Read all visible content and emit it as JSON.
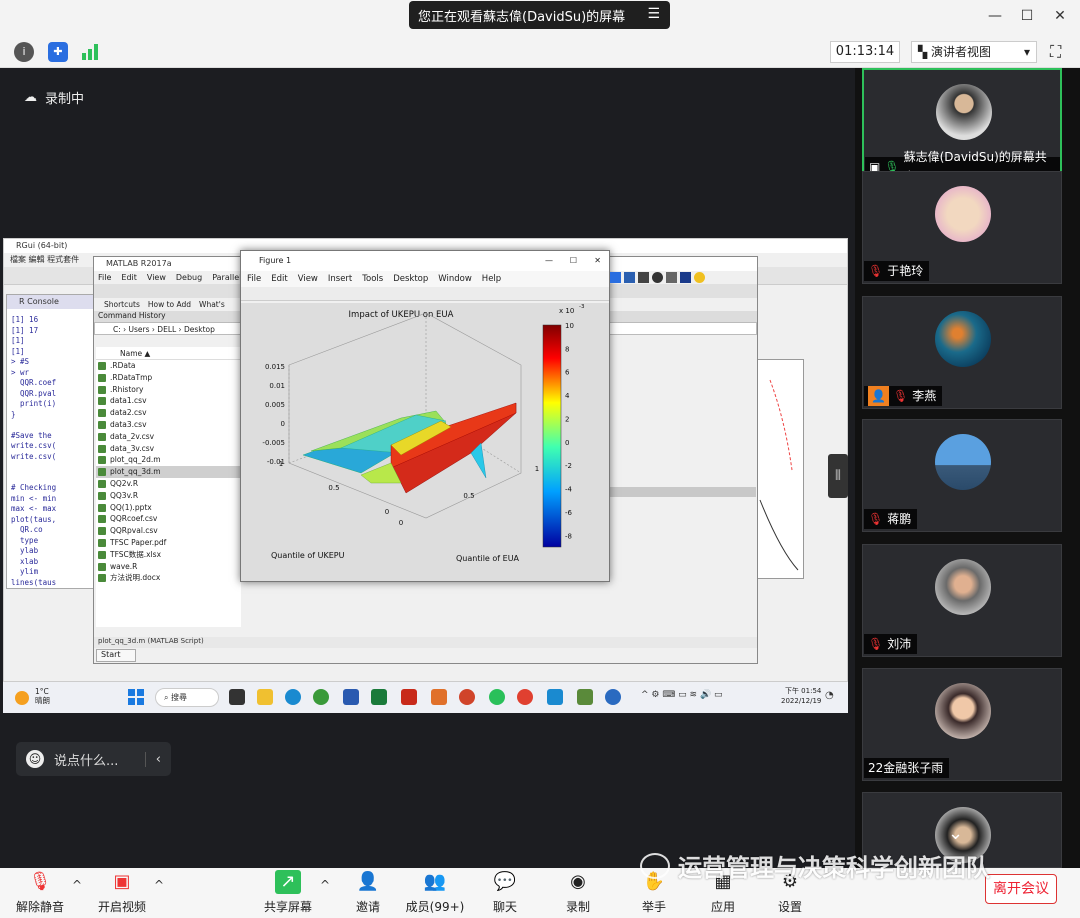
{
  "title_bar": {
    "share_banner": "您正在观看蘇志偉(DavidSu)的屏幕",
    "minimize": "—",
    "maximize": "☐",
    "close": "✕"
  },
  "info_bar": {
    "timer": "01:13:14",
    "view_label": "演讲者视图"
  },
  "stage": {
    "recording_label": "录制中"
  },
  "rgui": {
    "title": "RGui (64-bit)",
    "menu": "檔案  編輯  程式套件",
    "console_title": "R Console",
    "code": "[1] 16\n[1] 17\n[1]\n[1]\n> #S\n> wr\n  QQR.coef\n  QQR.pval\n  print(i)\n}\n\n#Save the\nwrite.csv(\nwrite.csv(\n\n\n# Checking\nmin <- min\nmax <- max\nplot(taus,\n  QR.co\n  type\n  ylab\n  xlab\n  ylim\nlines(taus"
  },
  "matlab": {
    "title": "MATLAB R2017a",
    "menu": [
      "File",
      "Edit",
      "View",
      "Debug",
      "Parallel"
    ],
    "shortcuts": "Shortcuts",
    "how_to_add": "How to Add",
    "whats_new": "What's",
    "panel": "Command History",
    "path": "C:  ›  Users  ›  DELL  ›  Desktop",
    "name_col": "Name ▲",
    "files": [
      ".RData",
      ".RDataTmp",
      ".Rhistory",
      "data1.csv",
      "data2.csv",
      "data3.csv",
      "data_2v.csv",
      "data_3v.csv",
      "plot_qq_2d.m",
      "plot_qq_3d.m",
      "QQ2v.R",
      "QQ3v.R",
      "QQ(1).pptx",
      "QQRcoef.csv",
      "QQRpval.csv",
      "TFSC Paper.pdf",
      "TFSC数据.xlsx",
      "wave.R",
      "方法说明.docx"
    ],
    "status": "plot_qq_3d.m (MATLAB Script)",
    "start": "Start"
  },
  "figure": {
    "title": "Figure 1",
    "menu": [
      "File",
      "Edit",
      "View",
      "Insert",
      "Tools",
      "Desktop",
      "Window",
      "Help"
    ]
  },
  "chart_data": {
    "type": "surface",
    "title": "Impact of UKEPU on EUA",
    "xlabel": "Quantile of UKEPU",
    "ylabel": "Quantile of EUA",
    "zlim": [
      -0.01,
      0.015
    ],
    "z_ticks": [
      "0.015",
      "0.01",
      "0.005",
      "0",
      "-0.005",
      "-0.01"
    ],
    "x_ticks": [
      "1",
      "0.5",
      "0"
    ],
    "y_ticks": [
      "0",
      "0.5",
      "1"
    ],
    "colorbar": {
      "label": "x 10",
      "exponent": "-3",
      "ticks": [
        "10",
        "8",
        "6",
        "4",
        "2",
        "0",
        "-2",
        "-4",
        "-6",
        "-8"
      ],
      "range": [
        -9,
        10
      ]
    }
  },
  "taskbar": {
    "weather_temp": "1°C",
    "weather_desc": "晴朗",
    "search": "搜尋",
    "time": "下午 01:54",
    "date": "2022/12/19"
  },
  "chat": {
    "placeholder": "说点什么..."
  },
  "participants": [
    {
      "name": "蘇志偉(DavidSu)的屏幕共享"
    },
    {
      "name": "于艳玲"
    },
    {
      "name": "李燕"
    },
    {
      "name": "蒋鹏"
    },
    {
      "name": "刘沛"
    },
    {
      "name": "22金融张子雨"
    },
    {
      "name": ""
    }
  ],
  "bottom_bar": {
    "unmute": "解除静音",
    "video": "开启视频",
    "share": "共享屏幕",
    "invite": "邀请",
    "members": "成员(99+)",
    "chat": "聊天",
    "record": "录制",
    "raise_hand": "举手",
    "apps": "应用",
    "settings": "设置",
    "leave": "离开会议"
  },
  "watermark": "运营管理与决策科学创新团队"
}
